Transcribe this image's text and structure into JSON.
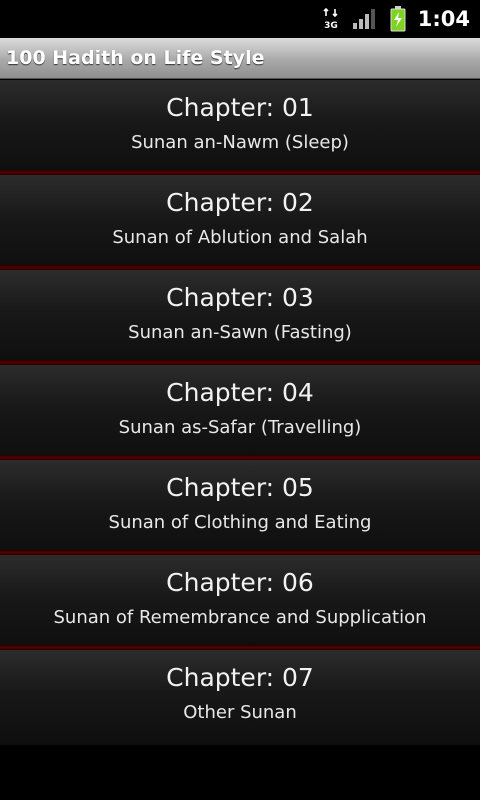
{
  "status_bar": {
    "network_label": "3G",
    "clock": "1:04",
    "icons": [
      "network-3g-icon",
      "signal-icon",
      "battery-charging-icon"
    ]
  },
  "app": {
    "title": "100 Hadith on Life Style"
  },
  "chapters": [
    {
      "number": "Chapter: 01",
      "name": "Sunan an-Nawm (Sleep)"
    },
    {
      "number": "Chapter: 02",
      "name": "Sunan of Ablution and Salah"
    },
    {
      "number": "Chapter: 03",
      "name": "Sunan an-Sawn (Fasting)"
    },
    {
      "number": "Chapter: 04",
      "name": "Sunan as-Safar (Travelling)"
    },
    {
      "number": "Chapter: 05",
      "name": "Sunan of Clothing and Eating"
    },
    {
      "number": "Chapter: 06",
      "name": "Sunan of Remembrance and Supplication"
    },
    {
      "number": "Chapter: 07",
      "name": "Other Sunan"
    }
  ],
  "colors": {
    "title_bar": "#a9a9a9",
    "divider": "#5a0000",
    "item_background": "#181818",
    "battery": "#7ed321"
  }
}
